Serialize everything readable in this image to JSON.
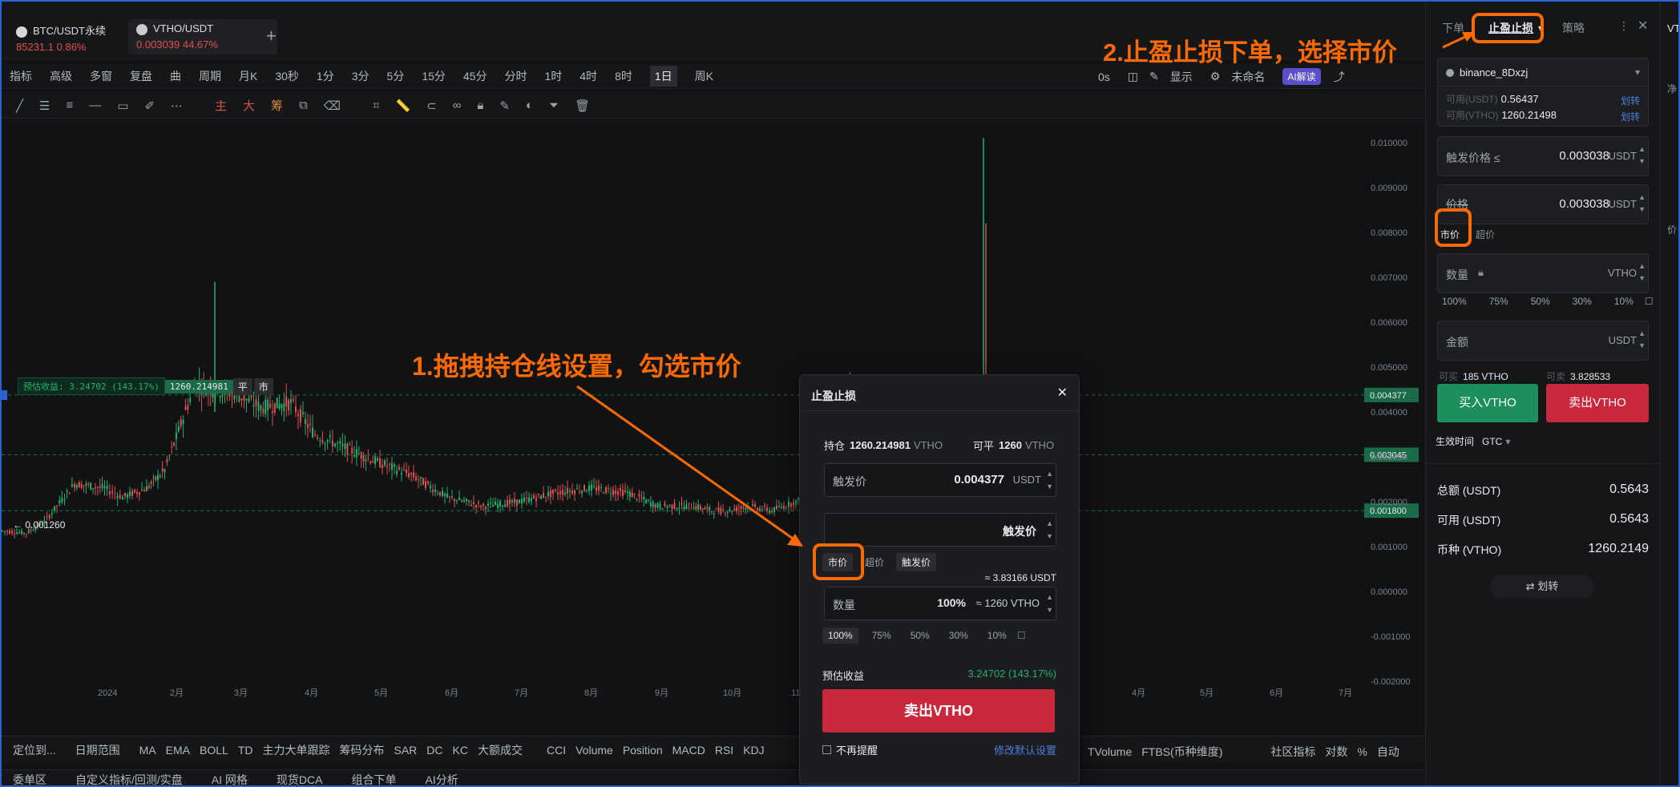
{
  "tabs": [
    {
      "name": "BTC/USDT永续",
      "price": "85231.1",
      "change": "0.86%"
    },
    {
      "name": "VTHO/USDT",
      "price": "0.003039",
      "change": "44.67%"
    }
  ],
  "add_tab": "+",
  "toolbar": {
    "left": [
      "指标",
      "高级",
      "多窗",
      "复盘",
      "曲",
      "周期",
      "月K",
      "30秒",
      "1分",
      "3分",
      "5分",
      "15分",
      "45分",
      "分时",
      "1时",
      "4时",
      "8时",
      "1日",
      "周K"
    ],
    "active": "1日",
    "right": [
      "0s",
      "显示",
      "未命名",
      "AI解读"
    ]
  },
  "draw_tools": {
    "letters": [
      "主",
      "大",
      "筹"
    ]
  },
  "chart_data": {
    "type": "line",
    "title": "",
    "xlabel": "",
    "ylabel": "",
    "ylim": [
      -0.0025,
      0.0105
    ],
    "y_ticks": [
      "0.010000",
      "0.009000",
      "0.008000",
      "0.007000",
      "0.006000",
      "0.005000",
      "0.004000",
      "0.003000",
      "0.002000",
      "0.001000",
      "0.000000",
      "-0.001000",
      "-0.002000"
    ],
    "y_tick_values": [
      0.01,
      0.009,
      0.008,
      0.007,
      0.006,
      0.005,
      0.004,
      0.003,
      0.002,
      0.001,
      0,
      -0.001,
      -0.002
    ],
    "x_ticks": [
      "2024",
      "2月",
      "3月",
      "4月",
      "5月",
      "6月",
      "7月",
      "8月",
      "9月",
      "10月",
      "11",
      "4月",
      "5月",
      "6月",
      "7月"
    ],
    "price_tags": [
      {
        "label": "0.004377",
        "value": 0.004377
      },
      {
        "label": "0.003045",
        "value": 0.003045
      },
      {
        "label": "0.001800",
        "value": 0.0018
      }
    ],
    "low_label": "← 0.001260",
    "position_line": {
      "label": "预估收益: 3.24702 (143.17%)",
      "qty": "1260.214981",
      "btn1": "平",
      "btn2": "市",
      "value": 0.004377
    },
    "series": [
      {
        "x": [
          0,
          0.02,
          0.035,
          0.06,
          0.085,
          0.1,
          0.12,
          0.135,
          0.16,
          0.175,
          0.195,
          0.215,
          0.24,
          0.26,
          0.285,
          0.31,
          0.34,
          0.37,
          0.4,
          0.43,
          0.46,
          0.49,
          0.52,
          0.545,
          0.575,
          0.59,
          0.605,
          0.62,
          0.64,
          0.66,
          0.675,
          0.69,
          0.705,
          0.72,
          0.735,
          0.75,
          0.77,
          0.79,
          0.815,
          0.83,
          0.84,
          0.85
        ],
        "y": [
          0.00135,
          0.0013,
          0.00155,
          0.0024,
          0.0023,
          0.0021,
          0.0023,
          0.0027,
          0.0046,
          0.0045,
          0.0044,
          0.0041,
          0.0042,
          0.0035,
          0.0032,
          0.0029,
          0.0026,
          0.0021,
          0.0019,
          0.002,
          0.0022,
          0.0023,
          0.0022,
          0.0019,
          0.0019,
          0.0018,
          0.0018,
          0.0019,
          0.0018,
          0.002,
          0.0021,
          0.0028,
          0.0045,
          0.0042,
          0.0033,
          0.003,
          0.0028,
          0.0026,
          0.0024,
          0.0022,
          0.0021,
          0.0032
        ]
      }
    ]
  },
  "bottom_bar": {
    "left": [
      "定位到...",
      "日期范围",
      "MA",
      "EMA",
      "BOLL",
      "TD",
      "主力大单跟踪",
      "筹码分布",
      "SAR",
      "DC",
      "KC",
      "大额成交",
      "CCI",
      "Volume",
      "Position",
      "MACD",
      "RSI",
      "KDJ"
    ],
    "right": [
      "TVolume",
      "FTBS(币种维度)",
      "社区指标",
      "对数",
      "%",
      "自动"
    ]
  },
  "bottom_tabs": [
    "委单区",
    "自定义指标/回测/实盘",
    "AI 网格",
    "现货DCA",
    "组合下单",
    "AI分析"
  ],
  "panel": {
    "tabs": [
      "下单",
      "止盈止损",
      "策略"
    ],
    "account": "binance_8Dxzj",
    "avail_usdt_label": "可用(USDT)",
    "avail_usdt": "0.56437",
    "avail_vtho_label": "可用(VTHO)",
    "avail_vtho": "1260.21498",
    "transfer": "划转",
    "trigger_label": "触发价格 ≤",
    "trigger_value": "0.003038",
    "unit_usdt": "USDT",
    "price_label": "价格",
    "price_value": "0.003038",
    "market": "市价",
    "limit": "超价",
    "qty_label": "数量",
    "unit_vtho": "VTHO",
    "pcts": [
      "100%",
      "75%",
      "50%",
      "30%",
      "10%"
    ],
    "amount_label": "金额",
    "buy_avail_label": "可买",
    "buy_avail": "185 VTHO",
    "sell_avail_label": "可卖",
    "sell_avail": "3.828533",
    "buy_btn": "买入VTHO",
    "sell_btn": "卖出VTHO",
    "tif_label": "生效时间",
    "tif": "GTC",
    "summary": [
      {
        "label": "总额 (USDT)",
        "value": "0.5643"
      },
      {
        "label": "可用 (USDT)",
        "value": "0.5643"
      },
      {
        "label": "币种 (VTHO)",
        "value": "1260.2149"
      }
    ],
    "transfer_btn": "⇄ 划转"
  },
  "far_right": [
    "VT",
    "净",
    "价"
  ],
  "dialog": {
    "title": "止盈止损",
    "hold_label": "持仓",
    "hold": "1260.214981",
    "hold_unit": "VTHO",
    "avail_label": "可平",
    "avail": "1260",
    "avail_unit": "VTHO",
    "trigger_label": "触发价",
    "trigger": "0.004377",
    "unit": "USDT",
    "price_mode_value": "触发价",
    "chips": [
      "市价",
      "超价",
      "触发价"
    ],
    "approx": "≈ 3.83166 USDT",
    "qty_label": "数量",
    "qty": "100%",
    "qty_eq": "≈ 1260 VTHO",
    "pcts": [
      "100%",
      "75%",
      "50%",
      "30%",
      "10%"
    ],
    "est_label": "预估收益",
    "est": "3.24702 (143.17%)",
    "sell_btn": "卖出VTHO",
    "no_remind": "不再提醒",
    "edit_default": "修改默认设置"
  },
  "annotations": {
    "step1": "1.拖拽持仓线设置，勾选市价",
    "step2": "2.止盈止损下单，选择市价"
  },
  "colors": {
    "up": "#20b26c",
    "down": "#e0504d",
    "accent": "#ff6a00",
    "sell": "#c9283d",
    "buy": "#1d8f5c"
  }
}
